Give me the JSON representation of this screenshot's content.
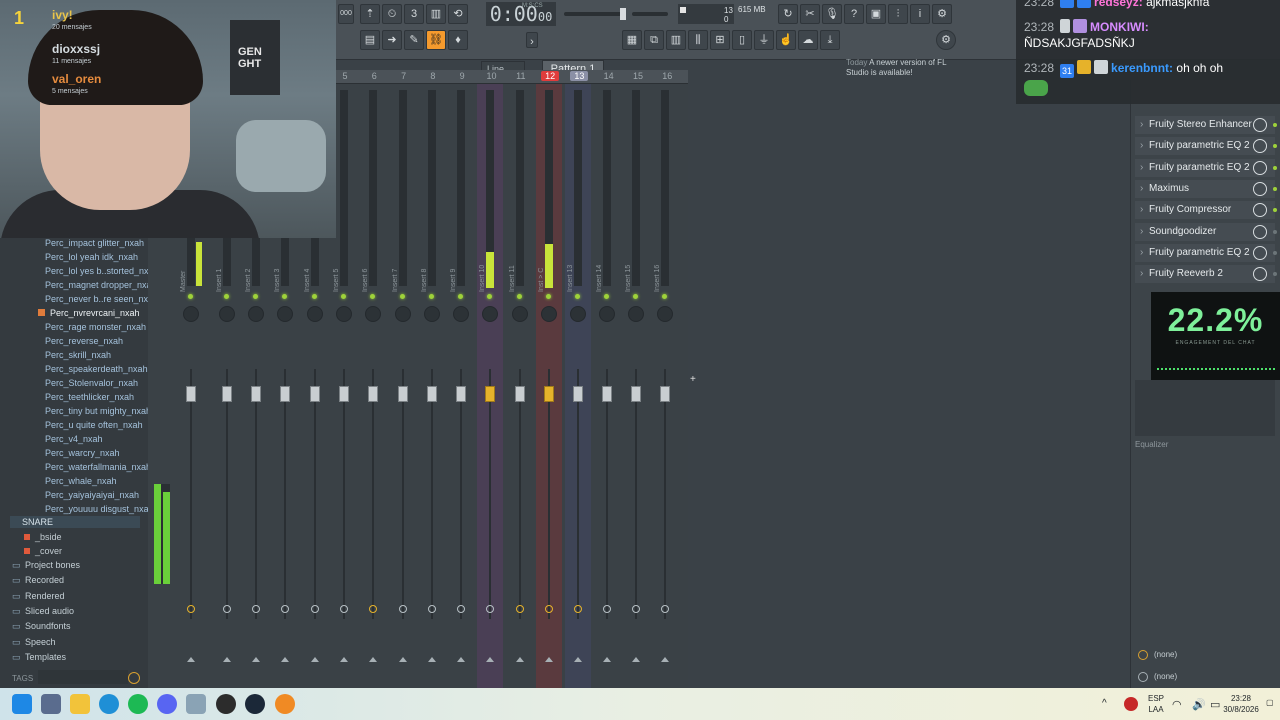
{
  "toolbar": {
    "time": "0:00",
    "time_ms": "00",
    "time_label": "M:S:CS",
    "tempo_small": "000",
    "cpu_num": "13",
    "mem_label": "615 MB",
    "mem_num": "0",
    "line_select": "Line",
    "pattern": "Pattern 1",
    "news_today": "Today",
    "news_text": "A newer version of FL Studio is available!"
  },
  "ruler": [
    "5",
    "6",
    "7",
    "8",
    "9",
    "10",
    "11",
    "12",
    "13",
    "14",
    "15",
    "16"
  ],
  "ruler_red": "12",
  "ruler_sel": "13",
  "browser": {
    "items": [
      "Perc_impact glitter_nxah",
      "Perc_lol yeah idk_nxah",
      "Perc_lol yes b..storted_nxah",
      "Perc_magnet dropper_nxah",
      "Perc_never b..re seen_nxah",
      "Perc_nvrevrcani_nxah",
      "Perc_rage monster_nxah",
      "Perc_reverse_nxah",
      "Perc_skrill_nxah",
      "Perc_speakerdeath_nxah",
      "Perc_Stolenvalor_nxah",
      "Perc_teethlicker_nxah",
      "Perc_tiny but mighty_nxah",
      "Perc_u quite often_nxah",
      "Perc_v4_nxah",
      "Perc_warcry_nxah",
      "Perc_waterfallmania_nxah",
      "Perc_whale_nxah",
      "Perc_yaiyaiyaiyai_nxah",
      "Perc_youuuu disgust_nxah"
    ],
    "snare": "SNARE",
    "subs": [
      "_bside",
      "_cover"
    ],
    "folders": [
      "Project bones",
      "Recorded",
      "Rendered",
      "Sliced audio",
      "Soundfonts",
      "Speech",
      "Templates"
    ],
    "tags": "TAGS"
  },
  "mixer": {
    "strips": [
      "Master",
      "Insert 1",
      "Insert 2",
      "Insert 3",
      "Insert 4",
      "Insert 5",
      "Insert 6",
      "Insert 7",
      "Insert 8",
      "Insert 9",
      "Insert 10",
      "Insert 11",
      "Inst > C",
      "Insert 13",
      "Insert 14",
      "Insert 15",
      "Insert 16"
    ]
  },
  "fx": {
    "slots": [
      "Fruity Stereo Enhancer",
      "Fruity parametric EQ 2",
      "Fruity parametric EQ 2",
      "Maximus",
      "Fruity Compressor",
      "Soundgoodizer",
      "Fruity parametric EQ 2",
      "Fruity Reeverb 2"
    ],
    "eq_label": "Equalizer",
    "none1": "(none)",
    "none2": "(none)"
  },
  "engagement": {
    "value": "22.2%",
    "caption": "ENGAGEMENT DEL CHAT"
  },
  "chat": [
    {
      "time": "23:28",
      "user": "redseyz:",
      "text": "ajkmasjknfa"
    },
    {
      "time": "23:28",
      "user": "MONKIWI:",
      "text": "ÑDSAKJGFADSÑKJ"
    },
    {
      "time": "23:28",
      "user": "kerenbnnt:",
      "text": "oh oh oh",
      "badge_num": "31"
    }
  ],
  "cam": {
    "rank": "1",
    "names": [
      "ivy!",
      "dioxxssj",
      "val_oren"
    ],
    "subs": [
      "20 mensajes",
      "11 mensajes",
      "5 mensajes"
    ],
    "poster_text": "GEN GHT"
  },
  "taskbar": {
    "lang1": "ESP",
    "lang2": "LAA",
    "time": "23:28",
    "date": "30/8/2026"
  }
}
